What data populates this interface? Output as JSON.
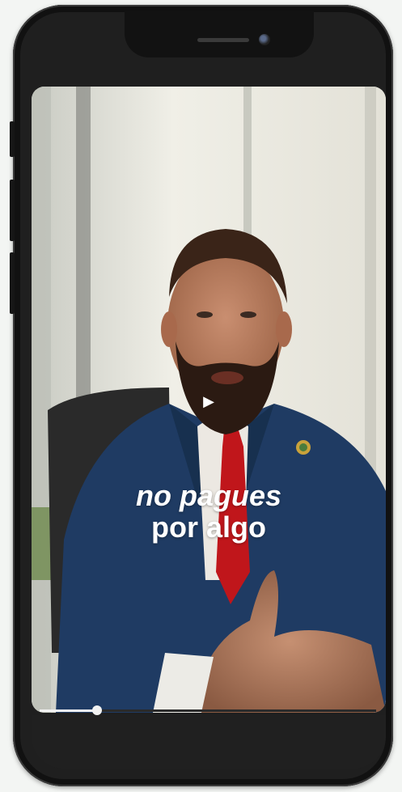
{
  "video": {
    "caption_line1": "no pagues",
    "caption_line2": "por algo",
    "play_icon": "play-icon",
    "progress": 0.17
  },
  "colors": {
    "suit": "#1f3b63",
    "tie": "#c0161b",
    "bezel": "#1f1f1f",
    "progress": "#f2f2f2"
  }
}
